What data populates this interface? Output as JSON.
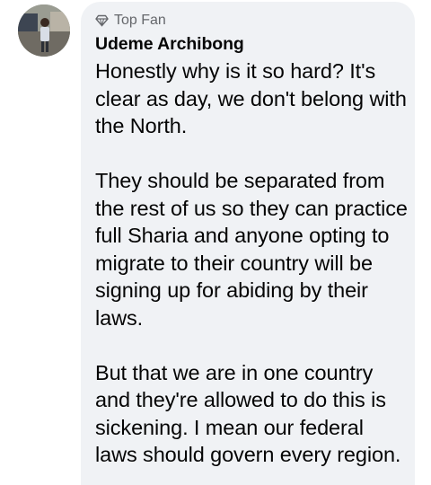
{
  "comment": {
    "badge_icon": "diamond-icon",
    "badge_label": "Top Fan",
    "author": "Udeme Archibong",
    "paragraphs": [
      "Honestly why is it so hard? It's clear as day, we don't belong with the North.",
      "They should be separated from the rest of us so they can practice full Sharia and anyone opting to migrate to their country will be signing up for abiding by their laws.",
      "But that we are in one country and they're allowed to do this is sickening. I mean our federal laws should govern every region."
    ]
  },
  "colors": {
    "bubble_background": "#f0f2f5",
    "secondary_text": "#65676b",
    "primary_text": "#050505"
  }
}
